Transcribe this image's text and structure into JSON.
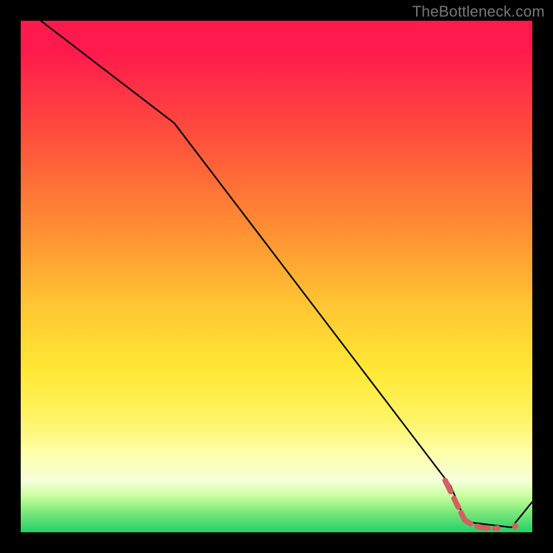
{
  "watermark": "TheBottleneck.com",
  "chart_data": {
    "type": "line",
    "title": "",
    "xlabel": "",
    "ylabel": "",
    "xlim": [
      0,
      100
    ],
    "ylim": [
      0,
      100
    ],
    "series": [
      {
        "name": "curve",
        "x": [
          4,
          30,
          84,
          87,
          96,
          100
        ],
        "y": [
          100,
          80,
          9,
          2,
          1,
          6
        ]
      }
    ],
    "highlight_band": {
      "name": "dashed-segment",
      "color": "#d96a6a",
      "x": [
        84,
        96
      ],
      "y": [
        9,
        1
      ]
    },
    "marker": {
      "name": "end-dot",
      "color": "#d96a6a",
      "x": 96.5,
      "y": 1.5
    }
  }
}
